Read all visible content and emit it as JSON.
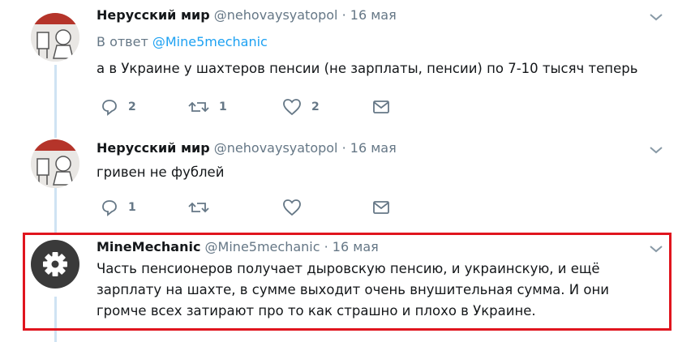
{
  "tweets": [
    {
      "name": "Нерусский мир",
      "handle": "@nehovaysyatopol",
      "dot": "·",
      "time": "16 мая",
      "reply_prefix": "В ответ",
      "reply_to": "@Mine5mechanic",
      "text": "а в Украине у шахтеров пенсии (не зарплаты, пенсии) по 7-10 тысяч теперь",
      "actions": {
        "replies": "2",
        "retweets": "1",
        "likes": "2"
      }
    },
    {
      "name": "Нерусский мир",
      "handle": "@nehovaysyatopol",
      "dot": "·",
      "time": "16 мая",
      "text": "гривен не фублей",
      "actions": {
        "replies": "1"
      }
    },
    {
      "name": "MineMechanic",
      "handle": "@Mine5mechanic",
      "dot": "·",
      "time": "16 мая",
      "text_lines": [
        "Часть пенсионеров получает дыровскую пенсию, и украинскую, и ещё",
        "зарплату на шахте, в сумме выходит очень внушительная сумма. И они",
        "громче всех затирают про то как страшно и плохо в Украине."
      ]
    }
  ],
  "icons": [
    "chevron-down-icon",
    "reply-icon",
    "retweet-icon",
    "like-icon",
    "direct-message-icon",
    "gear-icon"
  ],
  "colors": {
    "link": "#1da1f2",
    "muted": "#657786",
    "highlight_border": "#e0151e",
    "thread_line": "#cfe3f3"
  }
}
